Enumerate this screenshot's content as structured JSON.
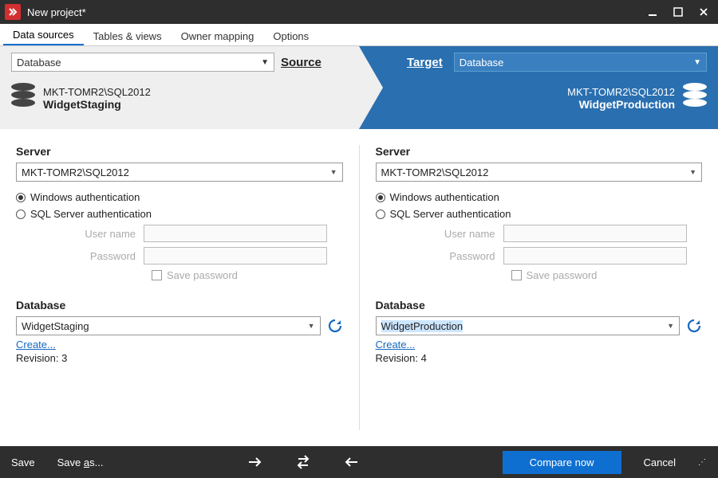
{
  "window": {
    "title": "New project*"
  },
  "tabs": {
    "data_sources": "Data sources",
    "tables_views": "Tables & views",
    "owner_mapping": "Owner mapping",
    "options": "Options"
  },
  "header": {
    "source_label": "Source",
    "target_label": "Target",
    "source_dd": "Database",
    "target_dd": "Database",
    "source_server": "MKT-TOMR2\\SQL2012",
    "source_db": "WidgetStaging",
    "target_server": "MKT-TOMR2\\SQL2012",
    "target_db": "WidgetProduction"
  },
  "form": {
    "server_label": "Server",
    "auth_windows": "Windows authentication",
    "auth_sql": "SQL Server authentication",
    "username_label": "User name",
    "password_label": "Password",
    "save_pw_label": "Save password",
    "database_label": "Database",
    "create_link": "Create...",
    "revision_prefix": "Revision: "
  },
  "source": {
    "server_value": "MKT-TOMR2\\SQL2012",
    "database_value": "WidgetStaging",
    "revision": "3"
  },
  "target": {
    "server_value": "MKT-TOMR2\\SQL2012",
    "database_value": "WidgetProduction",
    "revision": "4"
  },
  "footer": {
    "save": "Save",
    "save_as_pre": "Save ",
    "save_as_u": "a",
    "save_as_post": "s...",
    "compare": "Compare now",
    "cancel": "Cancel"
  }
}
